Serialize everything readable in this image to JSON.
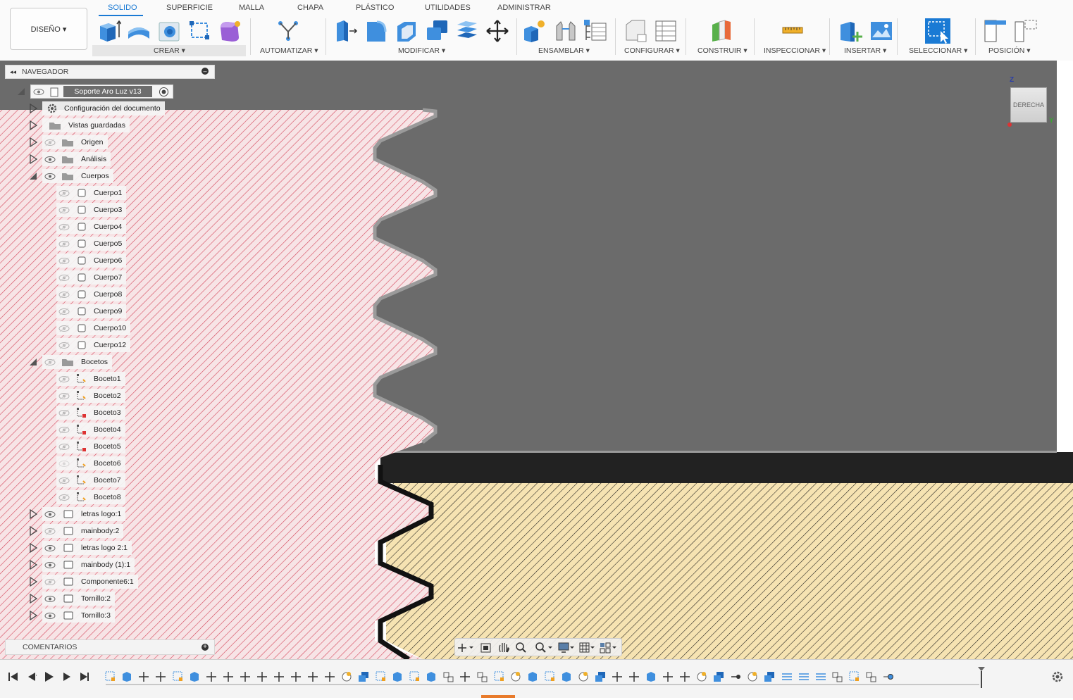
{
  "workspace": {
    "label": "DISEÑO ▾"
  },
  "tabs": [
    {
      "label": "SOLIDO",
      "active": true
    },
    {
      "label": "SUPERFICIE"
    },
    {
      "label": "MALLA"
    },
    {
      "label": "CHAPA"
    },
    {
      "label": "PLÁSTICO"
    },
    {
      "label": "UTILIDADES"
    },
    {
      "label": "ADMINISTRAR"
    }
  ],
  "groups": [
    "CREAR ▾",
    "AUTOMATIZAR ▾",
    "MODIFICAR ▾",
    "ENSAMBLAR ▾",
    "CONFIGURAR ▾",
    "CONSTRUIR ▾",
    "INSPECCIONAR ▾",
    "INSERTAR ▾",
    "SELECCIONAR ▾",
    "POSICIÓN ▾"
  ],
  "navigator": {
    "title": "NAVEGADOR",
    "document": "Soporte Aro Luz v13",
    "items": [
      "Configuración del documento",
      "Vistas guardadas",
      "Origen",
      "Análisis",
      "Cuerpos",
      "Cuerpo1",
      "Cuerpo3",
      "Cuerpo4",
      "Cuerpo5",
      "Cuerpo6",
      "Cuerpo7",
      "Cuerpo8",
      "Cuerpo9",
      "Cuerpo10",
      "Cuerpo12",
      "Bocetos",
      "Boceto1",
      "Boceto2",
      "Boceto3",
      "Boceto4",
      "Boceto5",
      "Boceto6",
      "Boceto7",
      "Boceto8",
      "letras logo:1",
      "mainbody:2",
      "letras logo 2:1",
      "mainbody (1):1",
      "Componente6:1",
      "Tornillo:2",
      "Tornillo:3"
    ]
  },
  "comments": {
    "title": "COMENTARIOS"
  },
  "viewcube": {
    "face": "DERECHA",
    "axis_z": "Z",
    "axis_y": "Y"
  },
  "colors": {
    "accent": "#1a7ad4",
    "section_red": "#d4465a",
    "section_tan": "#f4dfa8",
    "body_gray": "#6b6b6b"
  }
}
